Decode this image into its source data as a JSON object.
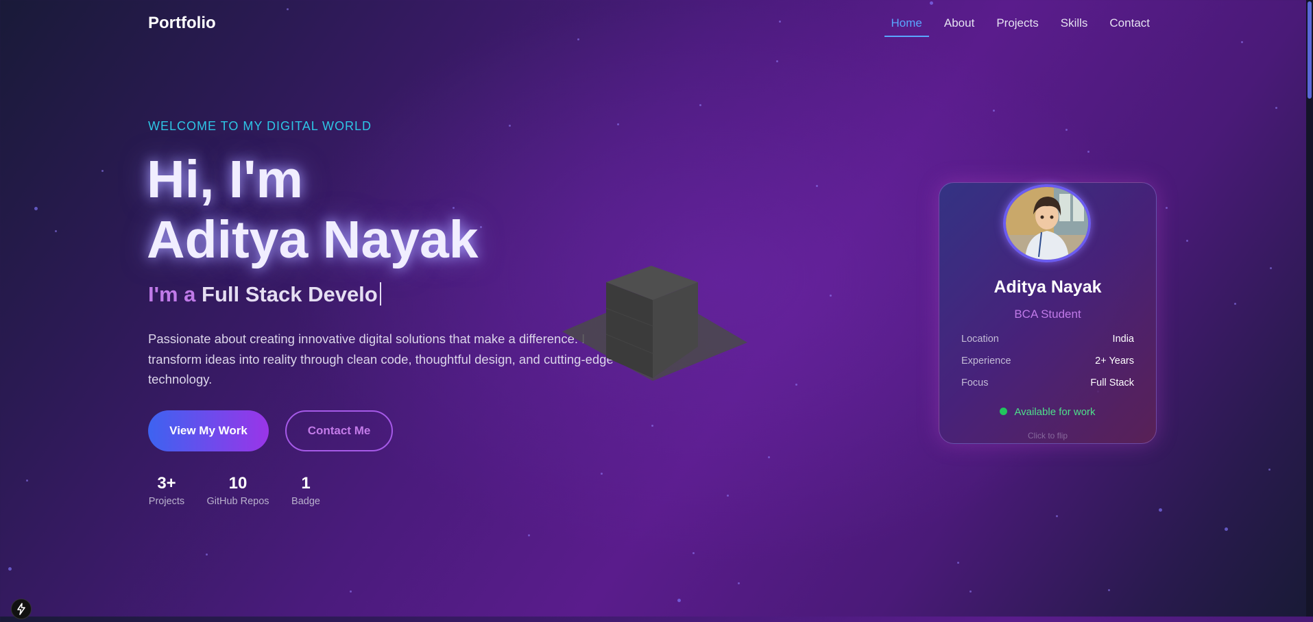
{
  "nav": {
    "brand": "Portfolio",
    "links": [
      "Home",
      "About",
      "Projects",
      "Skills",
      "Contact"
    ],
    "active": "Home"
  },
  "hero": {
    "welcome": "WELCOME TO MY DIGITAL WORLD",
    "greeting_line1": "Hi, I'm",
    "greeting_line2": "Aditya Nayak",
    "role_prefix": "I'm a",
    "role_typed": "Full Stack Develo",
    "description": "Passionate about creating innovative digital solutions that make a difference. I transform ideas into reality through clean code, thoughtful design, and cutting-edge technology.",
    "primary_button": "View My Work",
    "secondary_button": "Contact Me"
  },
  "stats": [
    {
      "value": "3+",
      "label": "Projects"
    },
    {
      "value": "10",
      "label": "GitHub Repos"
    },
    {
      "value": "1",
      "label": "Badge"
    }
  ],
  "profile_card": {
    "name": "Aditya Nayak",
    "title": "BCA Student",
    "rows": [
      {
        "key": "Location",
        "value": "India"
      },
      {
        "key": "Experience",
        "value": "2+ Years"
      },
      {
        "key": "Focus",
        "value": "Full Stack"
      }
    ],
    "availability": "Available for work",
    "hint": "Click to flip"
  },
  "colors": {
    "accent_cyan": "#2ec6e6",
    "accent_purple": "#c07ae8",
    "nav_active": "#5aa7ff",
    "status_green": "#22c55e"
  },
  "icons": {
    "bottom_left": "bolt-icon"
  }
}
